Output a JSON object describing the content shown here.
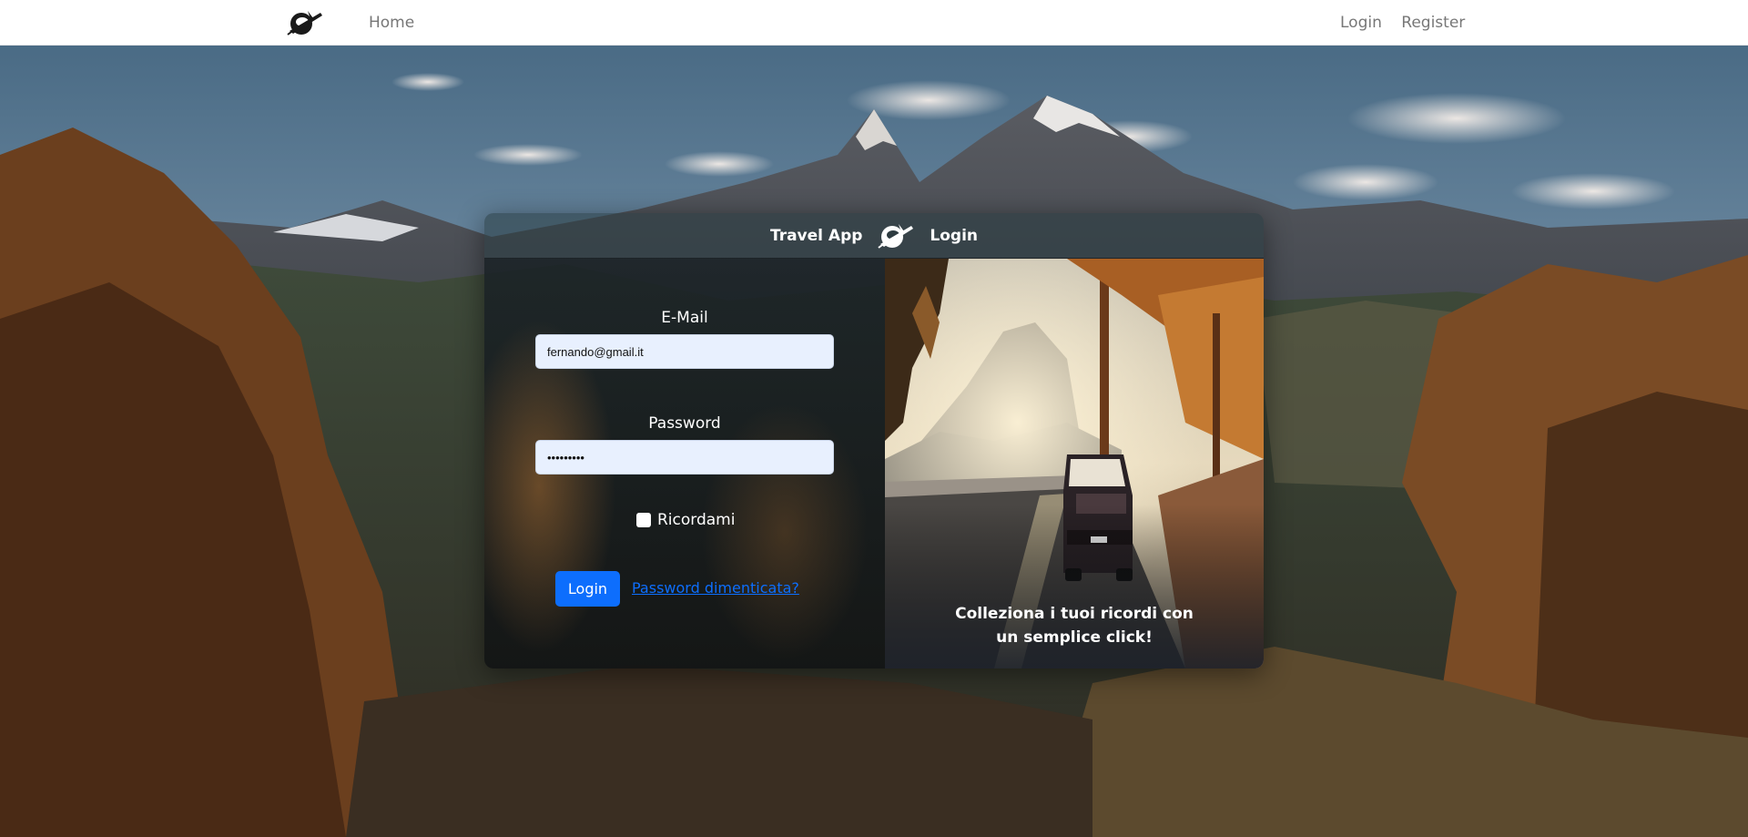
{
  "navbar": {
    "logo_icon": "astronaut-plane-icon",
    "home_label": "Home",
    "login_label": "Login",
    "register_label": "Register"
  },
  "card": {
    "header_app_name": "Travel App",
    "header_logo_icon": "astronaut-plane-icon",
    "header_title": "Login",
    "email": {
      "label": "E-Mail",
      "value": "fernando@gmail.it"
    },
    "password": {
      "label": "Password",
      "value": "•••••••••"
    },
    "remember_label": "Ricordami",
    "remember_checked": false,
    "login_button": "Login",
    "forgot_link": "Password dimenticata?",
    "caption": "Colleziona i tuoi ricordi con un semplice click!"
  },
  "colors": {
    "primary": "#0d6efd",
    "input_bg": "#e8f0fe",
    "nav_text": "#777777"
  }
}
